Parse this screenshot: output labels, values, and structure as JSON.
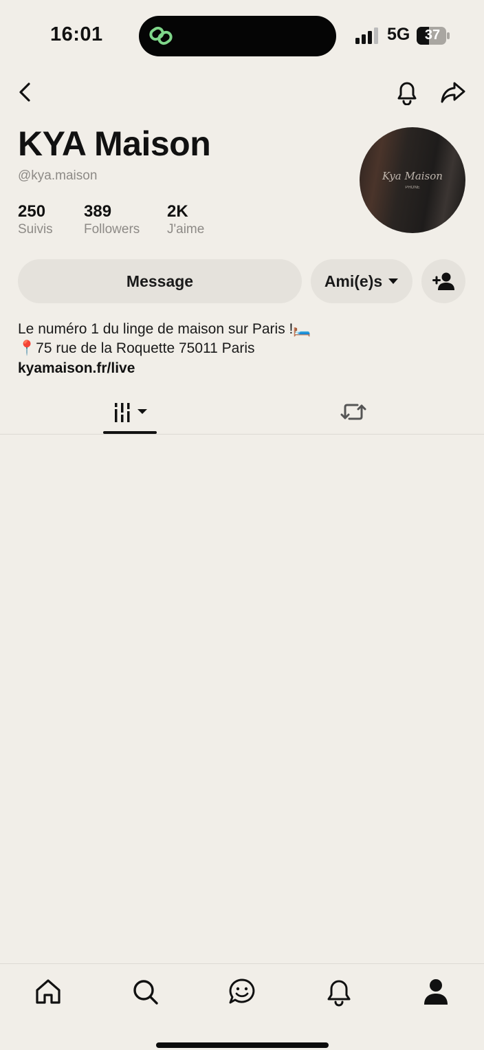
{
  "status_bar": {
    "time": "16:01",
    "network": "5G",
    "battery": "37"
  },
  "profile": {
    "name": "KYA Maison",
    "handle": "@kya.maison",
    "avatar_text": "Kya Maison",
    "avatar_subtext": "PHONE",
    "stats": [
      {
        "value": "250",
        "label": "Suivis"
      },
      {
        "value": "389",
        "label": "Followers"
      },
      {
        "value": "2K",
        "label": "J'aime"
      }
    ]
  },
  "actions": {
    "message_label": "Message",
    "friends_label": "Ami(e)s"
  },
  "bio": {
    "line1": "Le numéro 1 du linge de maison sur Paris !🛏️",
    "line2": "📍75 rue de la Roquette 75011 Paris",
    "link": "kyamaison.fr/live"
  },
  "tabs": [
    {
      "icon": "posts-grid-icon",
      "selected": true
    },
    {
      "icon": "repost-icon",
      "selected": false
    }
  ],
  "bottom_nav": [
    {
      "icon": "home-icon"
    },
    {
      "icon": "search-icon"
    },
    {
      "icon": "messages-icon"
    },
    {
      "icon": "notifications-icon"
    },
    {
      "icon": "profile-icon",
      "selected": true
    }
  ],
  "colors": {
    "background": "#f1eee8",
    "pill": "#e5e2dc",
    "secondary_text": "#8d8a86",
    "island_accent": "#7fd68a"
  }
}
